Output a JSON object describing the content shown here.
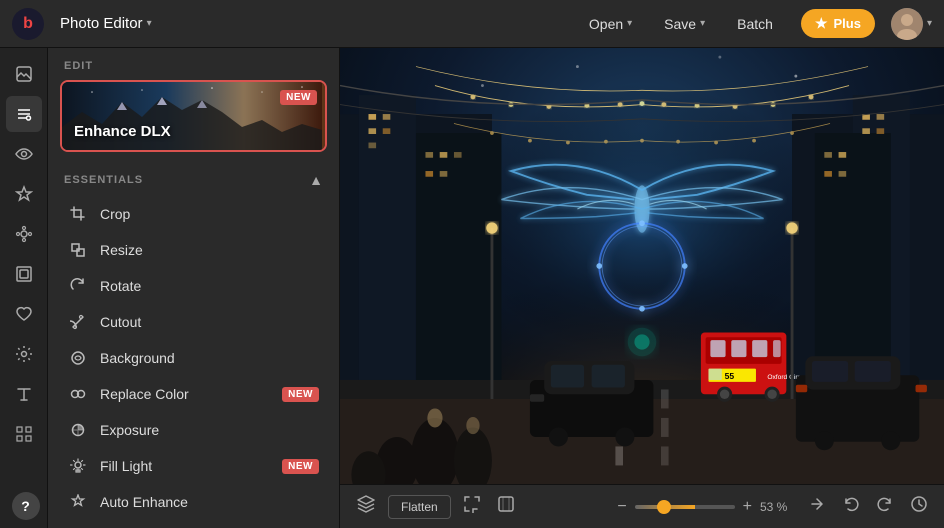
{
  "app": {
    "logo_text": "b",
    "title": "Photo Editor",
    "title_chevron": "▾"
  },
  "topbar": {
    "open_label": "Open",
    "save_label": "Save",
    "batch_label": "Batch",
    "plus_label": "Plus",
    "plus_star": "★",
    "chevron": "▾"
  },
  "edit_section": {
    "label": "EDIT",
    "enhance_card": {
      "title": "Enhance DLX",
      "badge": "NEW"
    }
  },
  "essentials": {
    "title": "ESSENTIALS",
    "collapse_icon": "▲",
    "tools": [
      {
        "name": "Crop",
        "icon": "crop"
      },
      {
        "name": "Resize",
        "icon": "resize"
      },
      {
        "name": "Rotate",
        "icon": "rotate"
      },
      {
        "name": "Cutout",
        "icon": "cutout"
      },
      {
        "name": "Background",
        "icon": "background"
      },
      {
        "name": "Replace Color",
        "icon": "replace-color",
        "badge": "NEW"
      },
      {
        "name": "Exposure",
        "icon": "exposure"
      },
      {
        "name": "Fill Light",
        "icon": "fill-light",
        "badge": "NEW"
      },
      {
        "name": "Auto Enhance",
        "icon": "auto-enhance"
      }
    ]
  },
  "toolbar": {
    "flatten_label": "Flatten",
    "zoom_value": "53",
    "zoom_pct": "53 %"
  },
  "icons": {
    "layers": "⊕",
    "fit_screen": "⤢",
    "fullscreen": "⛶",
    "zoom_out": "−",
    "zoom_in": "+",
    "rotate_left": "↺",
    "undo": "↩",
    "redo": "↪",
    "history": "🕐",
    "help": "?"
  }
}
